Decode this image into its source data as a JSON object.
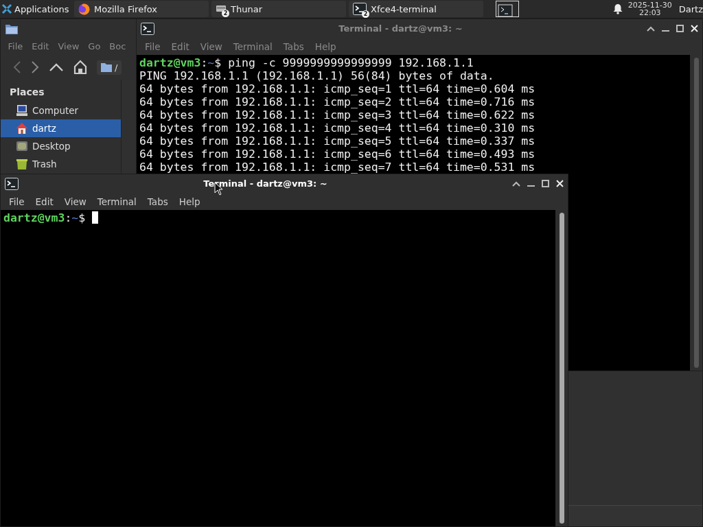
{
  "taskbar": {
    "menu_label": "Applications",
    "tasks": [
      {
        "label": "Mozilla Firefox",
        "kind": "browser"
      },
      {
        "label": "Thunar",
        "kind": "files",
        "badge": "2"
      },
      {
        "label": "Xfce4-terminal",
        "kind": "terminal",
        "badge": "2"
      }
    ],
    "date": "2025-11-30",
    "time": "22:03",
    "user": "Dartz"
  },
  "file_manager": {
    "menu": [
      "File",
      "Edit",
      "View",
      "Go",
      "Boc"
    ],
    "location": "/",
    "sidebar": {
      "heading": "Places",
      "items": [
        {
          "label": "Computer",
          "kind": "computer",
          "selected": false
        },
        {
          "label": "dartz",
          "kind": "home",
          "selected": true
        },
        {
          "label": "Desktop",
          "kind": "desktop",
          "selected": false
        },
        {
          "label": "Trash",
          "kind": "trash",
          "selected": false
        }
      ]
    }
  },
  "terminals": [
    {
      "title": "Terminal - dartz@vm3: ~",
      "active": false,
      "menu": [
        "File",
        "Edit",
        "View",
        "Terminal",
        "Tabs",
        "Help"
      ],
      "lines": [
        [
          {
            "text": "dartz@vm3",
            "kind": "user"
          },
          {
            "text": ":",
            "kind": "plain"
          },
          {
            "text": "~",
            "kind": "path"
          },
          {
            "text": "$ ping -c 9999999999999999 192.168.1.1",
            "kind": "plain"
          }
        ],
        [
          {
            "text": "PING 192.168.1.1 (192.168.1.1) 56(84) bytes of data.",
            "kind": "plain"
          }
        ],
        [
          {
            "text": "64 bytes from 192.168.1.1: icmp_seq=1 ttl=64 time=0.604 ms",
            "kind": "plain"
          }
        ],
        [
          {
            "text": "64 bytes from 192.168.1.1: icmp_seq=2 ttl=64 time=0.716 ms",
            "kind": "plain"
          }
        ],
        [
          {
            "text": "64 bytes from 192.168.1.1: icmp_seq=3 ttl=64 time=0.622 ms",
            "kind": "plain"
          }
        ],
        [
          {
            "text": "64 bytes from 192.168.1.1: icmp_seq=4 ttl=64 time=0.310 ms",
            "kind": "plain"
          }
        ],
        [
          {
            "text": "64 bytes from 192.168.1.1: icmp_seq=5 ttl=64 time=0.337 ms",
            "kind": "plain"
          }
        ],
        [
          {
            "text": "64 bytes from 192.168.1.1: icmp_seq=6 ttl=64 time=0.493 ms",
            "kind": "plain"
          }
        ],
        [
          {
            "text": "64 bytes from 192.168.1.1: icmp_seq=7 ttl=64 time=0.531 ms",
            "kind": "plain"
          }
        ]
      ],
      "cursor": false
    },
    {
      "title": "Terminal - dartz@vm3: ~",
      "active": true,
      "menu": [
        "File",
        "Edit",
        "View",
        "Terminal",
        "Tabs",
        "Help"
      ],
      "lines": [
        [
          {
            "text": "dartz@vm3",
            "kind": "user"
          },
          {
            "text": ":",
            "kind": "plain"
          },
          {
            "text": "~",
            "kind": "path"
          },
          {
            "text": "$",
            "kind": "plain"
          }
        ]
      ],
      "cursor": true
    }
  ]
}
